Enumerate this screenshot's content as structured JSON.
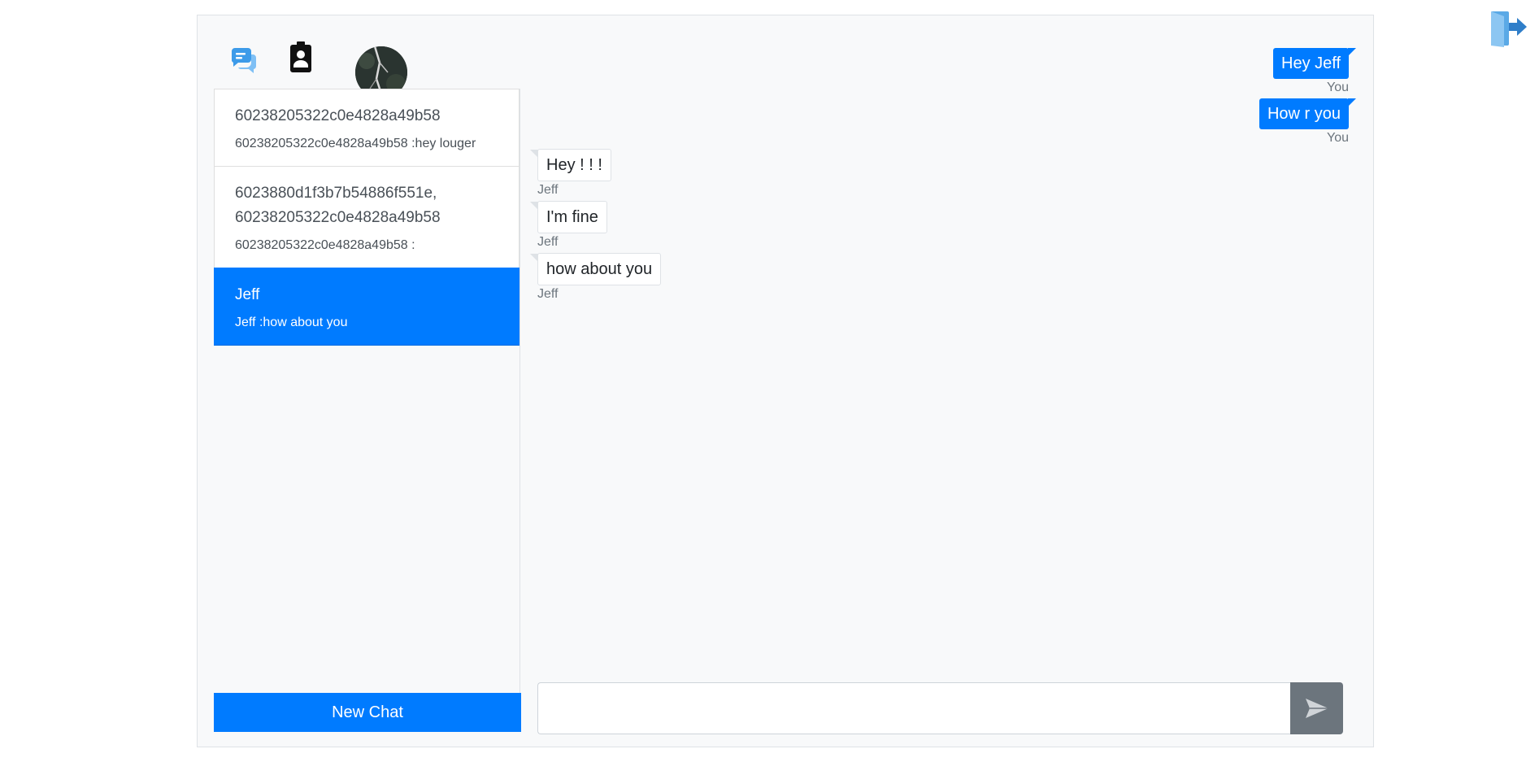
{
  "toolbar": {
    "chat_icon": "chat-bubbles-icon",
    "contacts_icon": "contacts-book-icon",
    "logout_icon": "logout-door-icon"
  },
  "conversations": [
    {
      "name": "60238205322c0e4828a49b58",
      "preview": "60238205322c0e4828a49b58 :hey louger",
      "active": false
    },
    {
      "name": "6023880d1f3b7b54886f551e, 60238205322c0e4828a49b58",
      "preview": "60238205322c0e4828a49b58 :",
      "active": false
    },
    {
      "name": "Jeff",
      "preview": "Jeff :how about you",
      "active": true
    }
  ],
  "new_chat_label": "New Chat",
  "messages": [
    {
      "text": "Hey Jeff",
      "sender": "You",
      "direction": "out"
    },
    {
      "text": "How r you",
      "sender": "You",
      "direction": "out"
    },
    {
      "text": "Hey ! ! !",
      "sender": "Jeff",
      "direction": "in"
    },
    {
      "text": "I'm fine",
      "sender": "Jeff",
      "direction": "in"
    },
    {
      "text": "how about you",
      "sender": "Jeff",
      "direction": "in"
    }
  ],
  "composer": {
    "value": "",
    "send_icon": "send-arrow-icon"
  },
  "colors": {
    "primary": "#007bff",
    "secondary": "#6c757d",
    "panel_bg": "#f8f9fa"
  }
}
